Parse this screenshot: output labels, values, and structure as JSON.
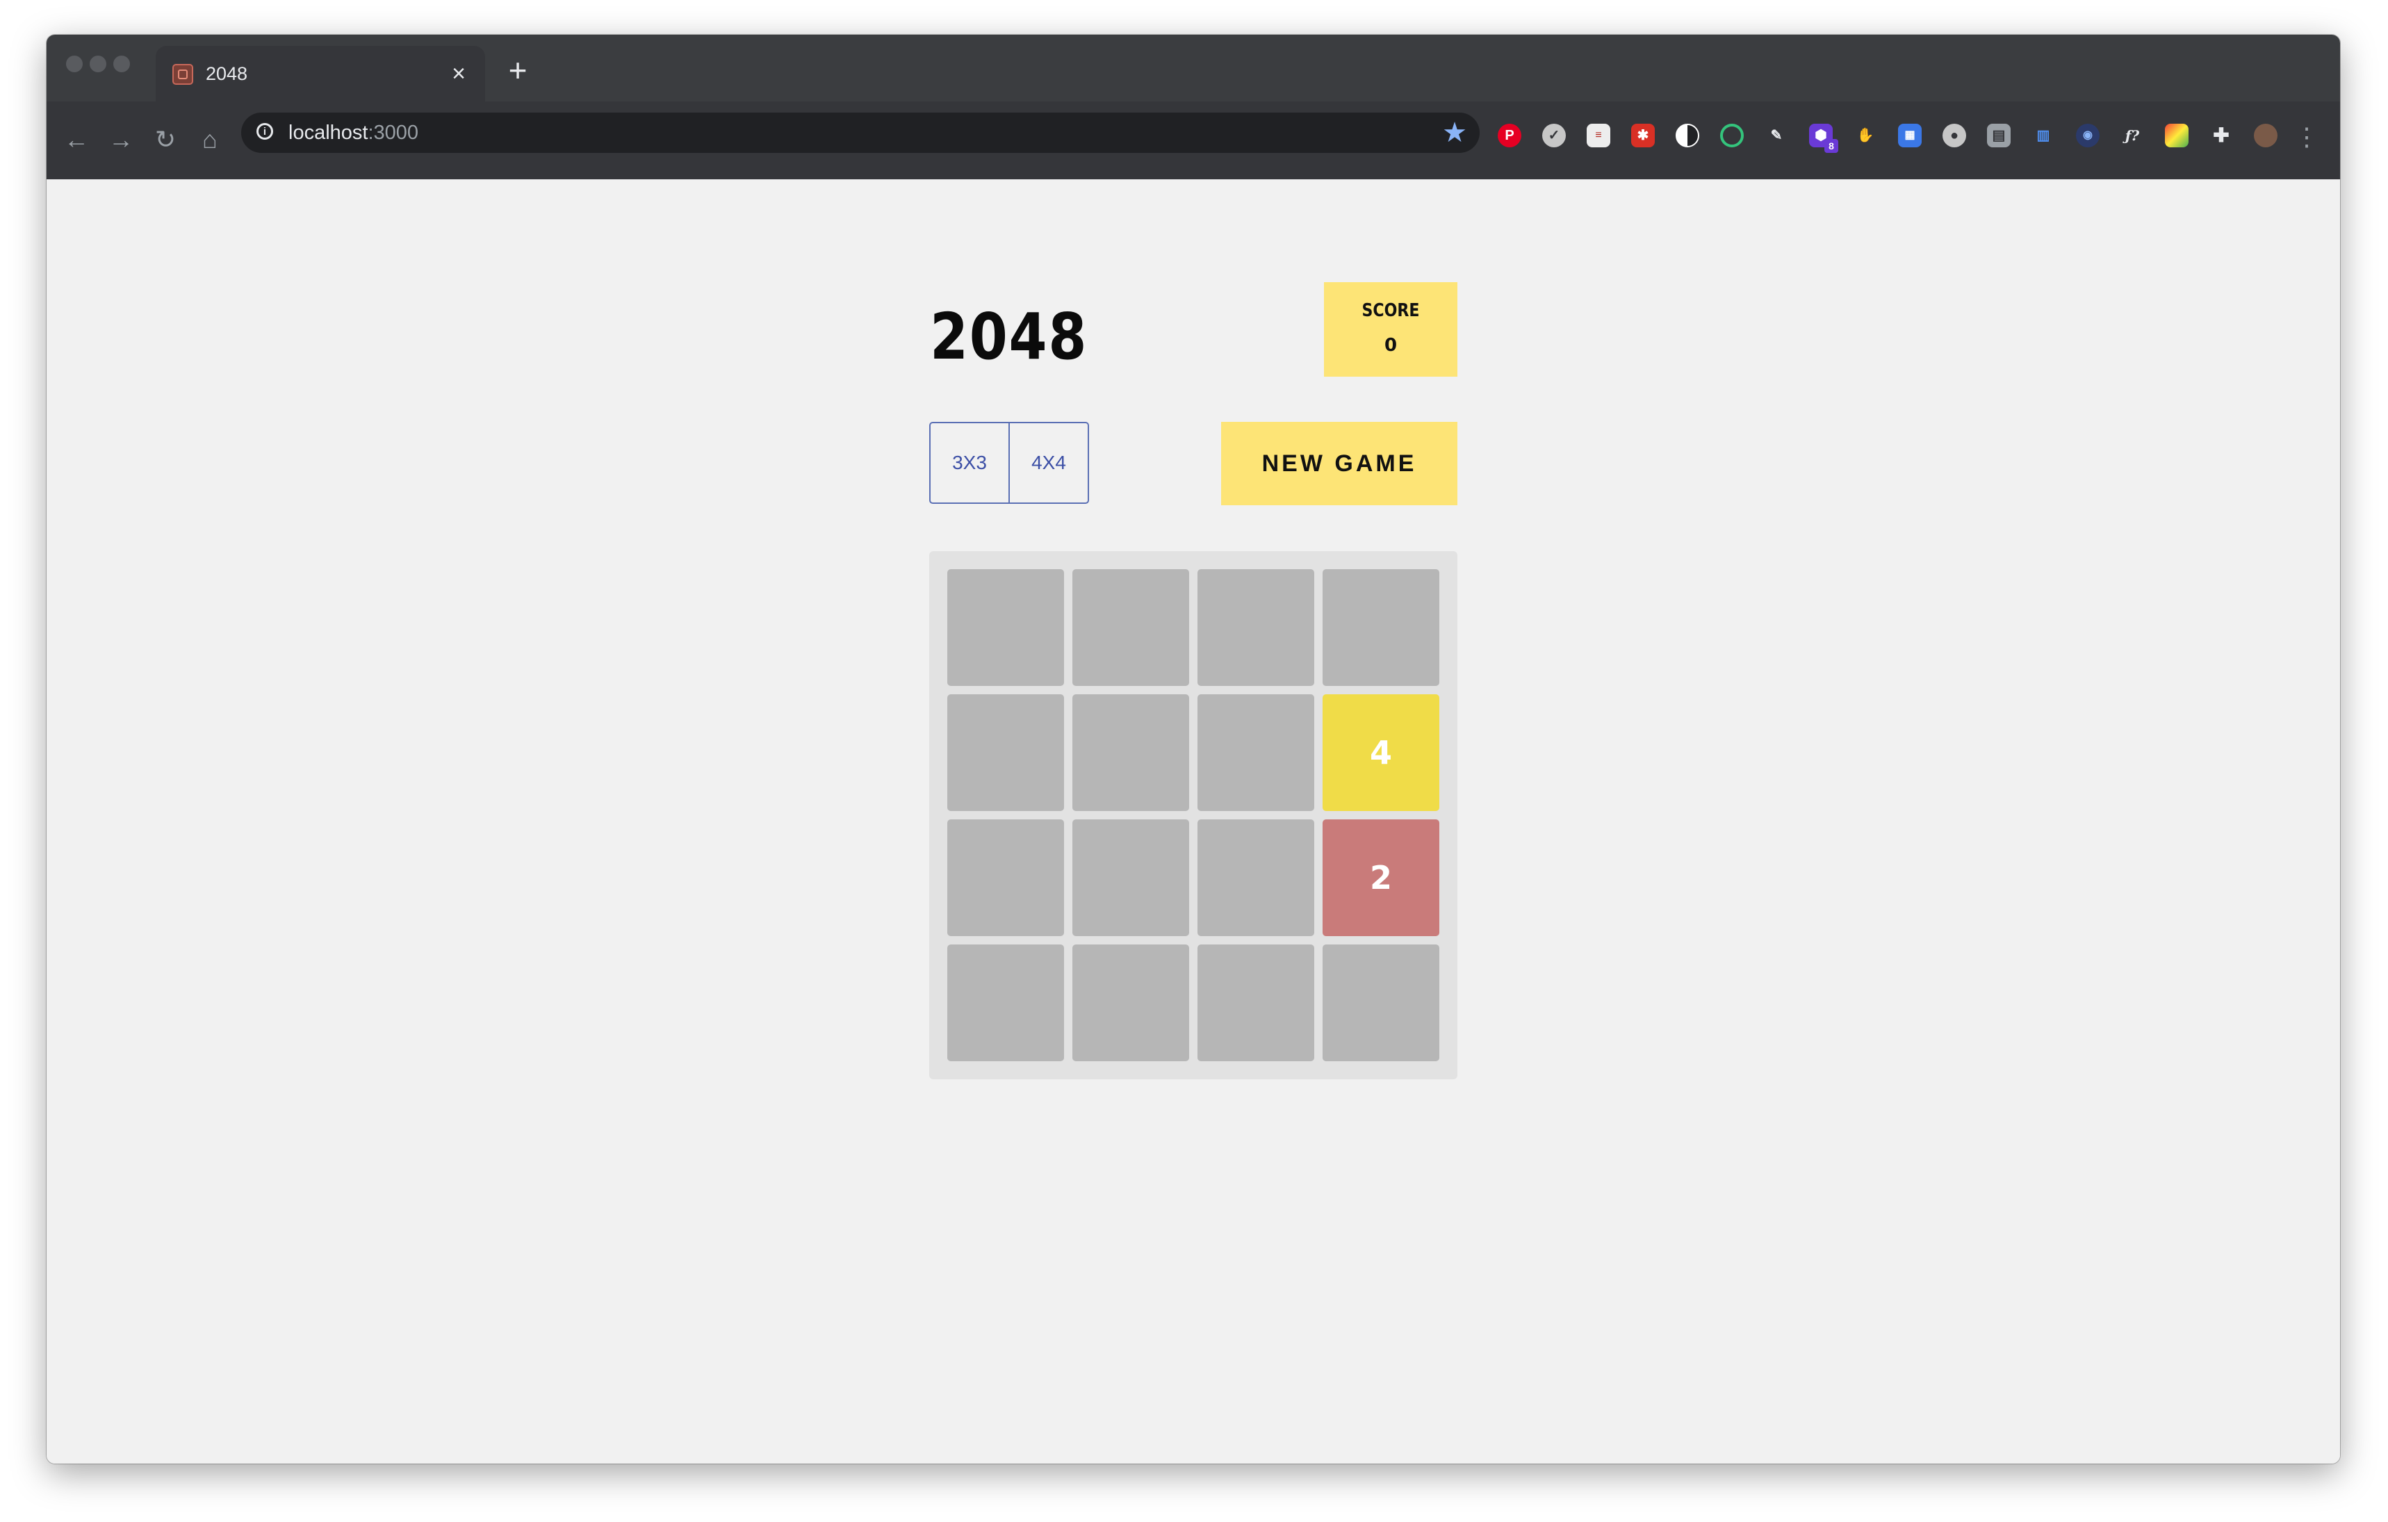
{
  "browser": {
    "tab_title": "2048",
    "tab_close": "×",
    "new_tab": "+",
    "url_host": "localhost",
    "url_port": ":3000",
    "nav": {
      "back": "←",
      "forward": "→",
      "reload": "↻",
      "home": "⌂"
    },
    "star": "★",
    "menu": "⋮",
    "extension_badge": "8"
  },
  "game": {
    "title": "2048",
    "score_label": "SCORE",
    "score_value": "0",
    "size_options": [
      "3X3",
      "4X4"
    ],
    "new_game_label": "NEW GAME",
    "board": [
      [
        "",
        "",
        "",
        ""
      ],
      [
        "",
        "",
        "",
        "4"
      ],
      [
        "",
        "",
        "",
        "2"
      ],
      [
        "",
        "",
        "",
        ""
      ]
    ]
  },
  "colors": {
    "accent_yellow": "#fde476",
    "tile_empty": "#b6b6b6",
    "tile_2": "#c97b7a",
    "tile_4": "#f0dc48",
    "board_bg": "#e2e2e2",
    "button_outline": "#5a6fb4"
  }
}
